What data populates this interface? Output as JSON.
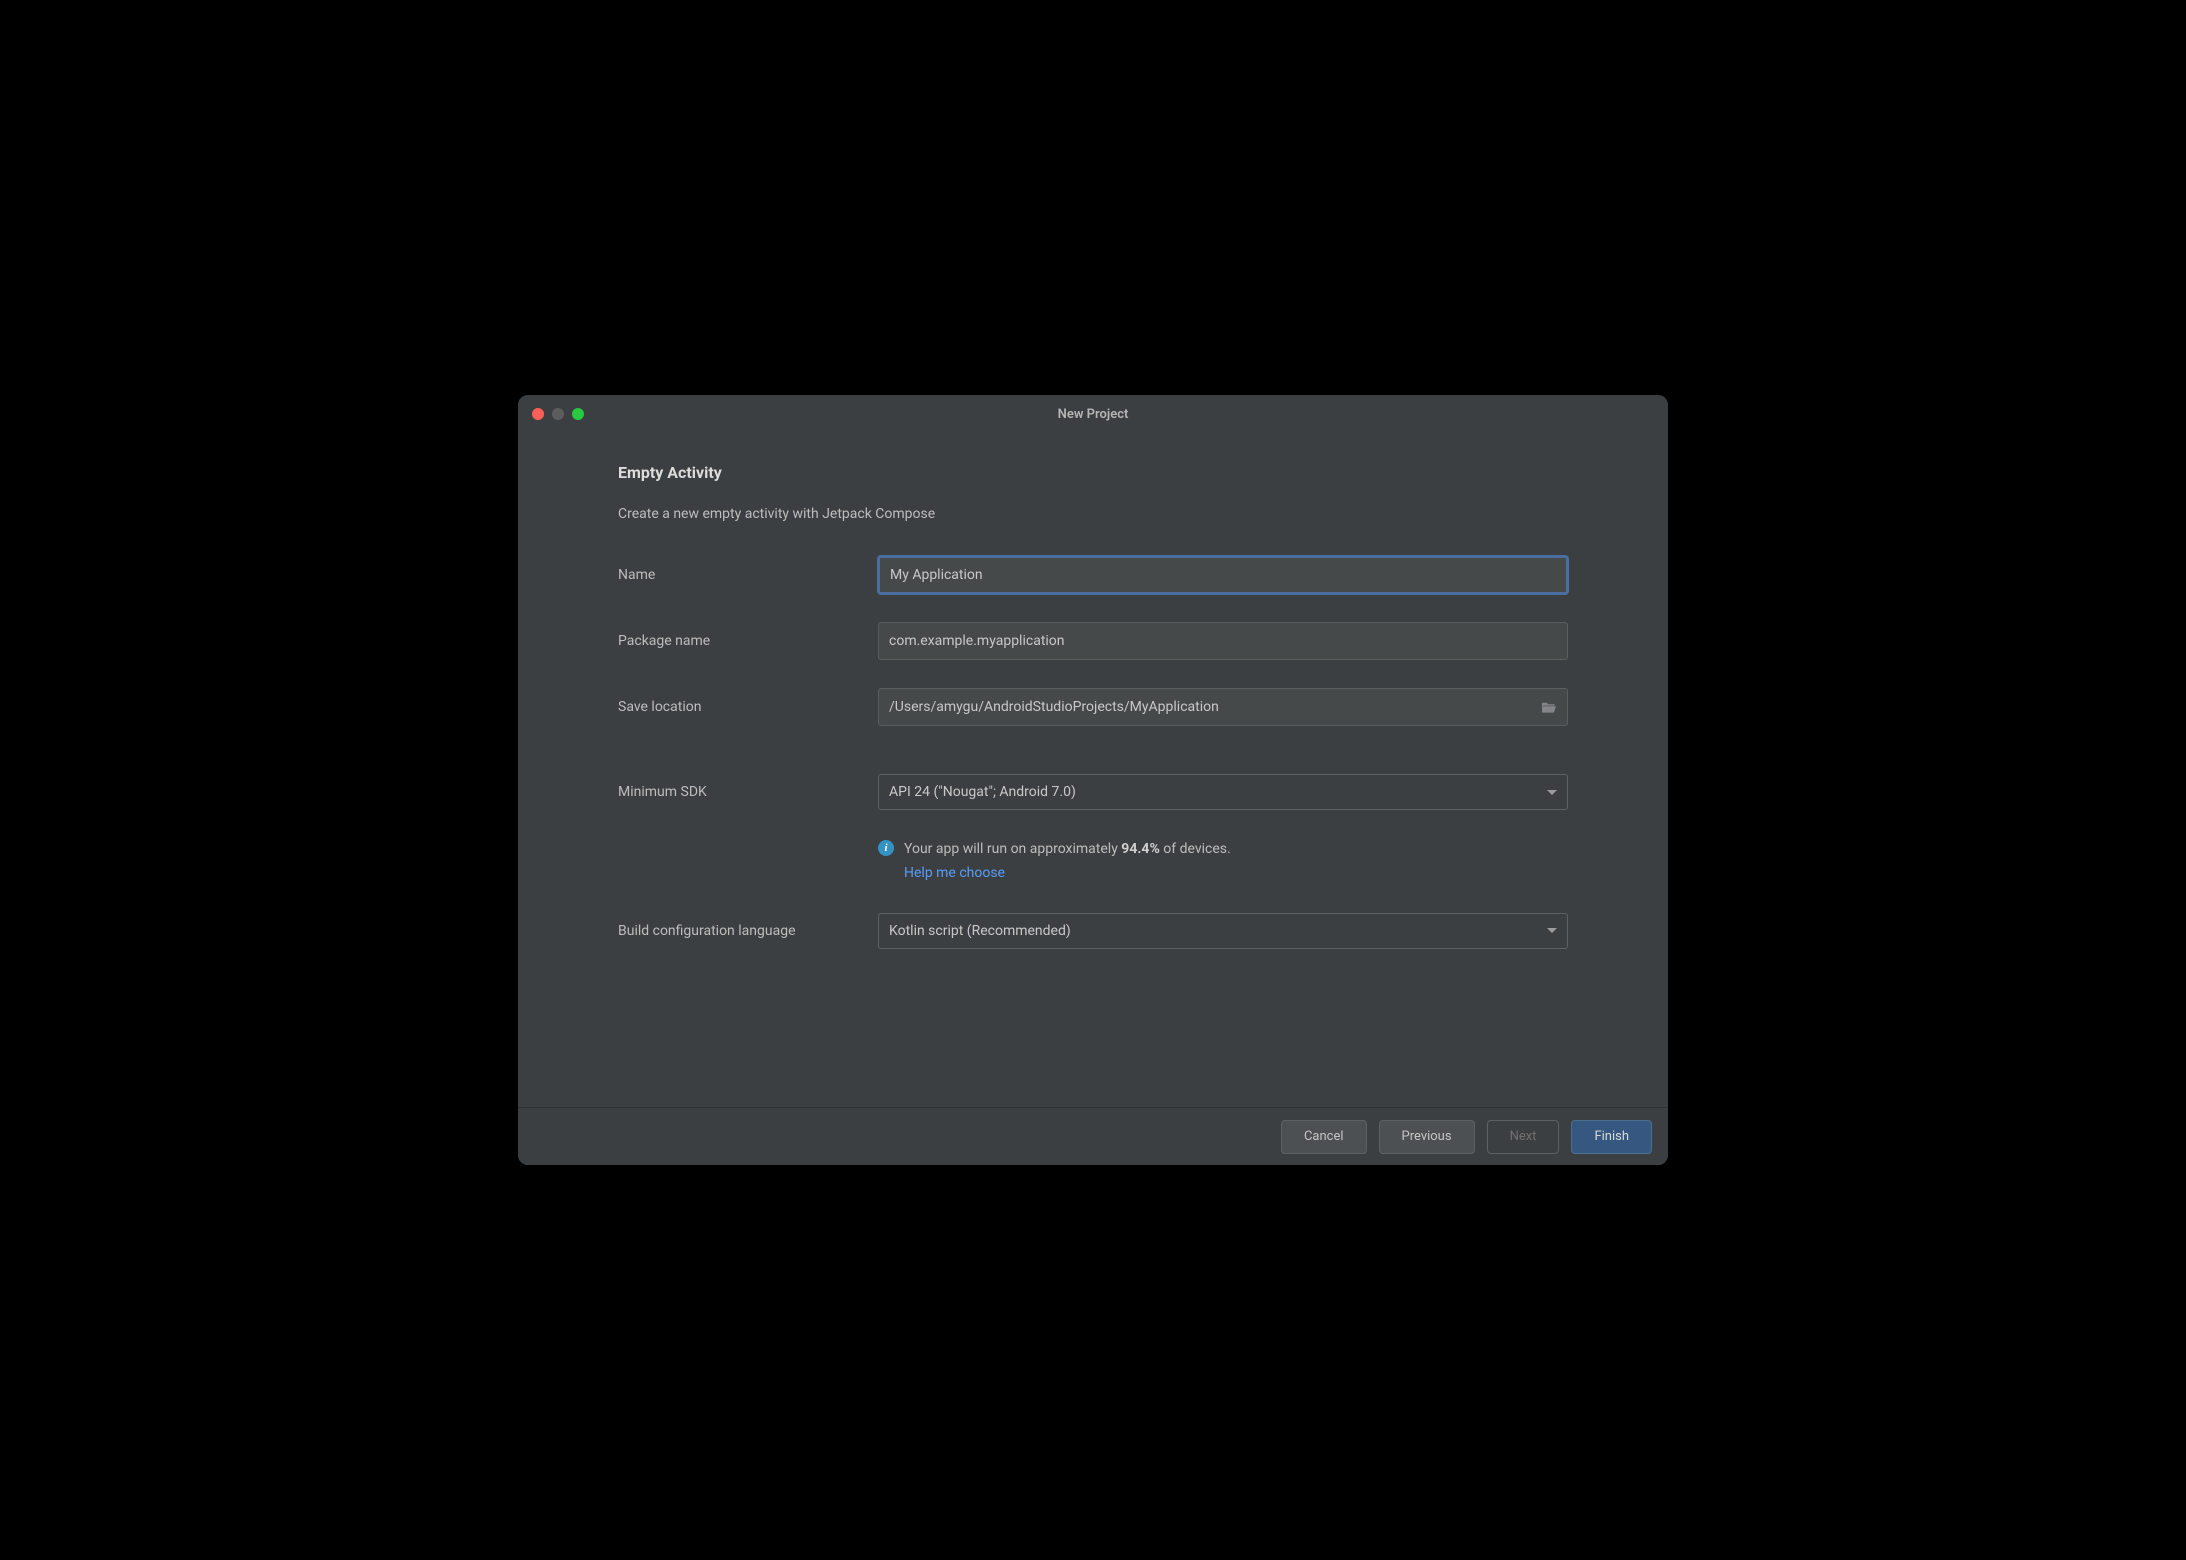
{
  "window": {
    "title": "New Project"
  },
  "page": {
    "heading": "Empty Activity",
    "subtitle": "Create a new empty activity with Jetpack Compose"
  },
  "form": {
    "name": {
      "label": "Name",
      "value": "My Application"
    },
    "package_name": {
      "label": "Package name",
      "value": "com.example.myapplication"
    },
    "save_location": {
      "label": "Save location",
      "value": "/Users/amygu/AndroidStudioProjects/MyApplication"
    },
    "minimum_sdk": {
      "label": "Minimum SDK",
      "selected": "API 24 (\"Nougat\"; Android 7.0)"
    },
    "build_config": {
      "label": "Build configuration language",
      "selected": "Kotlin script (Recommended)"
    }
  },
  "info": {
    "text_prefix": "Your app will run on approximately ",
    "percent": "94.4%",
    "text_suffix": " of devices.",
    "help_link": "Help me choose"
  },
  "buttons": {
    "cancel": "Cancel",
    "previous": "Previous",
    "next": "Next",
    "finish": "Finish"
  }
}
